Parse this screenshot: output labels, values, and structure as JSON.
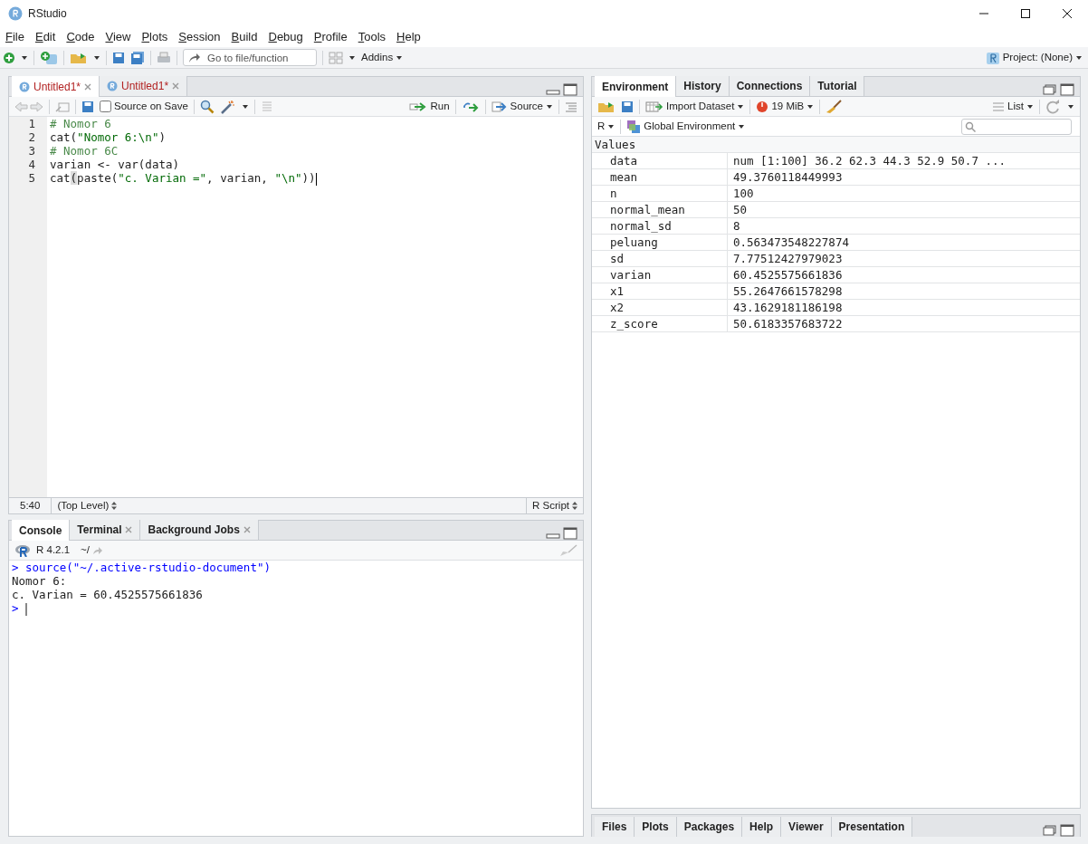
{
  "window": {
    "title": "RStudio"
  },
  "menu": [
    "File",
    "Edit",
    "Code",
    "View",
    "Plots",
    "Session",
    "Build",
    "Debug",
    "Profile",
    "Tools",
    "Help"
  ],
  "toolbar": {
    "goto_placeholder": "Go to file/function",
    "addins": "Addins",
    "project": "Project: (None)"
  },
  "source_pane": {
    "tabs": [
      {
        "label": "Untitled1*",
        "selected": true,
        "closable": true
      },
      {
        "label": "Untitled1*",
        "selected": false,
        "closable": true
      }
    ],
    "source_on_save": {
      "label": "Source on Save",
      "checked": false
    },
    "run": "Run",
    "source": "Source",
    "lines": [
      {
        "number": "1",
        "cursor": false,
        "tokens": [
          {
            "kind": "comment",
            "text": "# Nomor 6"
          }
        ]
      },
      {
        "number": "2",
        "cursor": false,
        "tokens": [
          {
            "kind": "plain",
            "text": "cat("
          },
          {
            "kind": "string",
            "text": "\"Nomor 6:\\n\""
          },
          {
            "kind": "plain",
            "text": ")"
          }
        ]
      },
      {
        "number": "3",
        "cursor": false,
        "tokens": [
          {
            "kind": "comment",
            "text": "# Nomor 6C"
          }
        ]
      },
      {
        "number": "4",
        "cursor": false,
        "tokens": [
          {
            "kind": "plain",
            "text": "varian <- var(data)"
          }
        ]
      },
      {
        "number": "5",
        "cursor": true,
        "tokens": [
          {
            "kind": "plain",
            "text": "cat"
          },
          {
            "kind": "match",
            "text": "("
          },
          {
            "kind": "plain",
            "text": "paste("
          },
          {
            "kind": "string",
            "text": "\"c. Varian =\""
          },
          {
            "kind": "plain",
            "text": ", varian, "
          },
          {
            "kind": "string",
            "text": "\"\\n\""
          },
          {
            "kind": "plain",
            "text": "))"
          }
        ]
      }
    ],
    "status": {
      "position": "5:40",
      "scope": "(Top Level)",
      "file_type": "R Script"
    }
  },
  "console_pane": {
    "tabs": [
      {
        "label": "Console",
        "selected": true,
        "closable": false
      },
      {
        "label": "Terminal",
        "selected": false,
        "closable": true
      },
      {
        "label": "Background Jobs",
        "selected": false,
        "closable": true
      }
    ],
    "version": "R 4.2.1",
    "path": "~/",
    "lines": [
      {
        "kind": "input",
        "prompt": ">",
        "text": "source(\"~/.active-rstudio-document\")"
      },
      {
        "kind": "output",
        "text": "Nomor 6:"
      },
      {
        "kind": "output",
        "text": "c. Varian = 60.4525575661836"
      },
      {
        "kind": "prompt",
        "prompt": ">"
      }
    ]
  },
  "environment_pane": {
    "tabs": [
      {
        "label": "Environment",
        "selected": true
      },
      {
        "label": "History",
        "selected": false
      },
      {
        "label": "Connections",
        "selected": false
      },
      {
        "label": "Tutorial",
        "selected": false
      }
    ],
    "import": "Import Dataset",
    "memory": "19 MiB",
    "view": "List",
    "language": "R",
    "scope": "Global Environment",
    "section": "Values",
    "rows": [
      {
        "name": "data",
        "value": "num [1:100] 36.2 62.3 44.3 52.9 50.7 ..."
      },
      {
        "name": "mean",
        "value": "49.3760118449993"
      },
      {
        "name": "n",
        "value": "100"
      },
      {
        "name": "normal_mean",
        "value": "50"
      },
      {
        "name": "normal_sd",
        "value": "8"
      },
      {
        "name": "peluang",
        "value": "0.563473548227874"
      },
      {
        "name": "sd",
        "value": "7.77512427979023"
      },
      {
        "name": "varian",
        "value": "60.4525575661836"
      },
      {
        "name": "x1",
        "value": "55.2647661578298"
      },
      {
        "name": "x2",
        "value": "43.1629181186198"
      },
      {
        "name": "z_score",
        "value": "50.6183357683722"
      }
    ]
  },
  "files_pane": {
    "tabs": [
      {
        "label": "Files",
        "selected": false
      },
      {
        "label": "Plots",
        "selected": false
      },
      {
        "label": "Packages",
        "selected": false
      },
      {
        "label": "Help",
        "selected": false
      },
      {
        "label": "Viewer",
        "selected": false
      },
      {
        "label": "Presentation",
        "selected": false
      }
    ]
  }
}
